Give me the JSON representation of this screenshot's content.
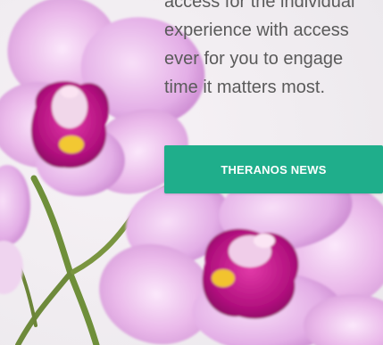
{
  "page": {
    "background": "#f3f1f4",
    "text_color": "#5a5a5a"
  },
  "intro": {
    "lines": [
      "access for the individual",
      "experience with access",
      "ever for you to engage",
      "time it matters most."
    ]
  },
  "cta": {
    "label": "THERANOS NEWS",
    "color": "#1fae8b"
  },
  "imagery": {
    "subject": "orchid-flowers-icon",
    "petal_color": "#e8b6e8",
    "throat_color": "#c2178f"
  }
}
